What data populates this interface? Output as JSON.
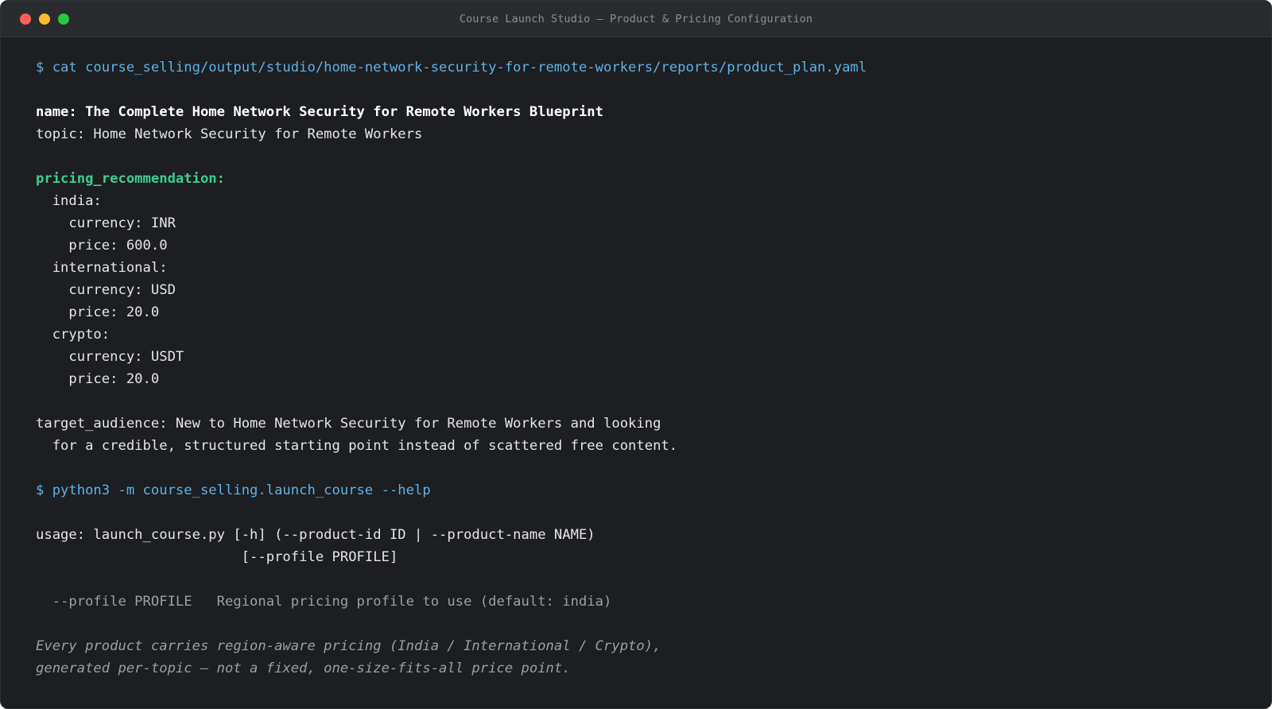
{
  "window": {
    "title": "Course Launch Studio — Product & Pricing Configuration",
    "colors": {
      "close": "#ff5f57",
      "minimize": "#febc2e",
      "maximize": "#28c840"
    }
  },
  "terminal": {
    "command1": "$ cat course_selling/output/studio/home-network-security-for-remote-workers/reports/product_plan.yaml",
    "name_line": "name: The Complete Home Network Security for Remote Workers Blueprint",
    "topic_line": "topic: Home Network Security for Remote Workers",
    "pricing_header": "pricing_recommendation:",
    "pricing": {
      "india_label": "  india:",
      "india_currency": "    currency: INR",
      "india_price": "    price: 600.0",
      "international_label": "  international:",
      "international_currency": "    currency: USD",
      "international_price": "    price: 20.0",
      "crypto_label": "  crypto:",
      "crypto_currency": "    currency: USDT",
      "crypto_price": "    price: 20.0"
    },
    "target_audience_1": "target_audience: New to Home Network Security for Remote Workers and looking",
    "target_audience_2": "  for a credible, structured starting point instead of scattered free content.",
    "command2": "$ python3 -m course_selling.launch_course --help",
    "usage_1": "usage: launch_course.py [-h] (--product-id ID | --product-name NAME)",
    "usage_2": "                         [--profile PROFILE]",
    "option_line": "  --profile PROFILE   Regional pricing profile to use (default: india)",
    "note_1": "Every product carries region-aware pricing (India / International / Crypto),",
    "note_2": "generated per-topic — not a fixed, one-size-fits-all price point."
  }
}
